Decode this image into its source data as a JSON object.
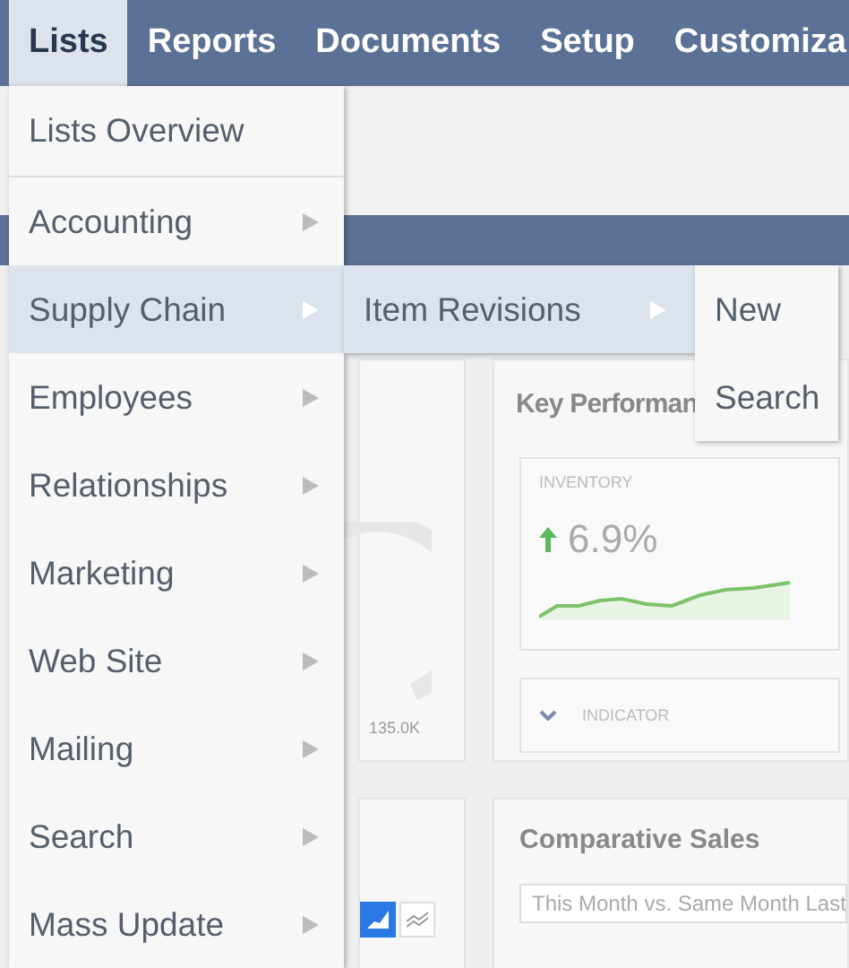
{
  "nav": {
    "tabs": [
      {
        "label": "Lists",
        "selected": true
      },
      {
        "label": "Reports",
        "selected": false
      },
      {
        "label": "Documents",
        "selected": false
      },
      {
        "label": "Setup",
        "selected": false
      },
      {
        "label": "Customiza",
        "selected": false
      }
    ]
  },
  "dashboard": {
    "gauge_card": {
      "value_label": "135.0K",
      "chart_toggles": [
        {
          "kind": "area",
          "selected": true
        },
        {
          "kind": "line",
          "selected": false
        }
      ]
    },
    "kpi_card": {
      "title": "Key Performan",
      "kpi": {
        "label": "INVENTORY",
        "value": "6.9%"
      },
      "indicator": {
        "label": "INDICATOR"
      }
    },
    "sales_card": {
      "title": "Comparative Sales",
      "period": "This Month vs. Same Month Last"
    }
  },
  "menu": {
    "items": [
      {
        "label": "Lists Overview",
        "submenu": false,
        "selected": false
      },
      {
        "label": "Accounting",
        "submenu": true,
        "selected": false
      },
      {
        "label": "Supply Chain",
        "submenu": true,
        "selected": true
      },
      {
        "label": "Employees",
        "submenu": true,
        "selected": false
      },
      {
        "label": "Relationships",
        "submenu": true,
        "selected": false
      },
      {
        "label": "Marketing",
        "submenu": true,
        "selected": false
      },
      {
        "label": "Web Site",
        "submenu": true,
        "selected": false
      },
      {
        "label": "Mailing",
        "submenu": true,
        "selected": false
      },
      {
        "label": "Search",
        "submenu": true,
        "selected": false
      },
      {
        "label": "Mass Update",
        "submenu": true,
        "selected": false
      }
    ]
  },
  "submenu": {
    "items": [
      {
        "label": "Item Revisions",
        "submenu": true,
        "selected": true
      }
    ]
  },
  "submenu_2": {
    "items": [
      {
        "label": "New",
        "selected": false
      },
      {
        "label": "Search",
        "selected": false
      }
    ]
  }
}
